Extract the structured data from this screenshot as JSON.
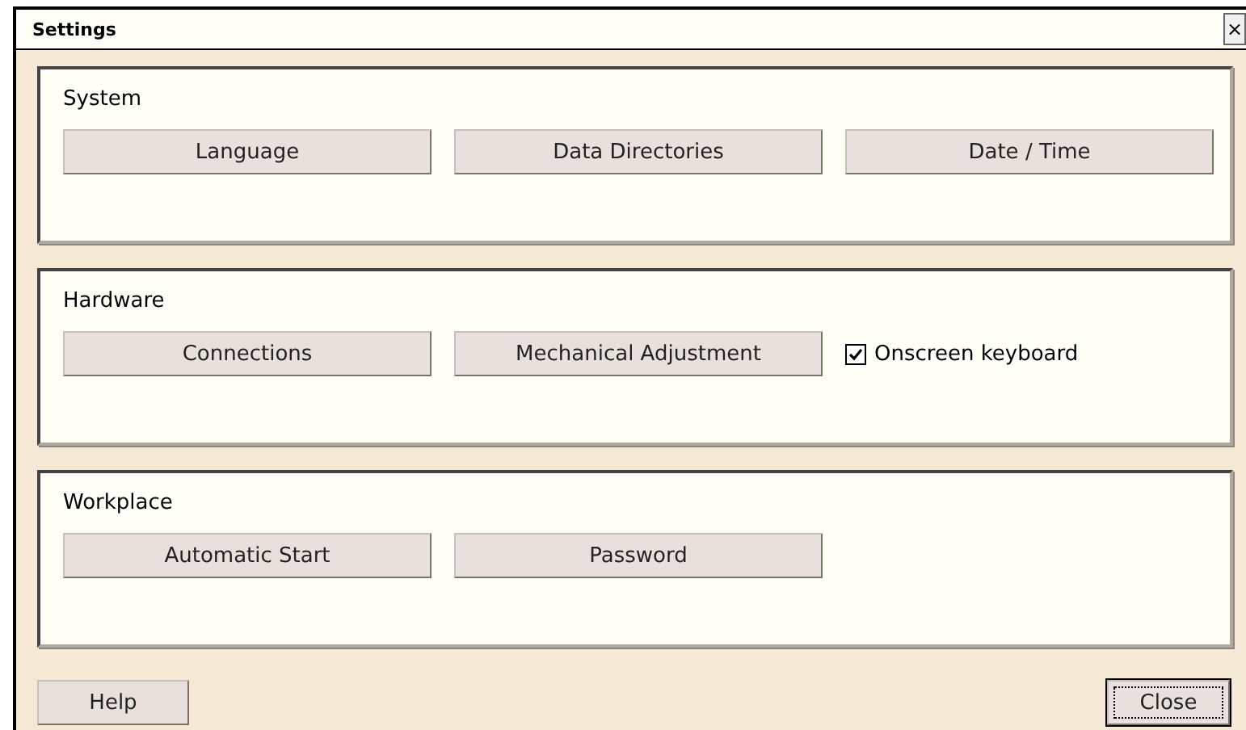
{
  "window": {
    "title": "Settings",
    "close_glyph": "×"
  },
  "groups": [
    {
      "title": "System",
      "items": [
        {
          "kind": "button",
          "label": "Language"
        },
        {
          "kind": "button",
          "label": "Data Directories"
        },
        {
          "kind": "button",
          "label": "Date / Time"
        }
      ]
    },
    {
      "title": "Hardware",
      "items": [
        {
          "kind": "button",
          "label": "Connections"
        },
        {
          "kind": "button",
          "label": "Mechanical Adjustment"
        },
        {
          "kind": "checkbox",
          "label": "Onscreen keyboard",
          "checked": true
        }
      ]
    },
    {
      "title": "Workplace",
      "items": [
        {
          "kind": "button",
          "label": "Automatic Start"
        },
        {
          "kind": "button",
          "label": "Password"
        }
      ]
    }
  ],
  "footer": [
    {
      "label": "Help",
      "focused": false
    },
    {
      "label": "Close",
      "focused": true
    }
  ]
}
